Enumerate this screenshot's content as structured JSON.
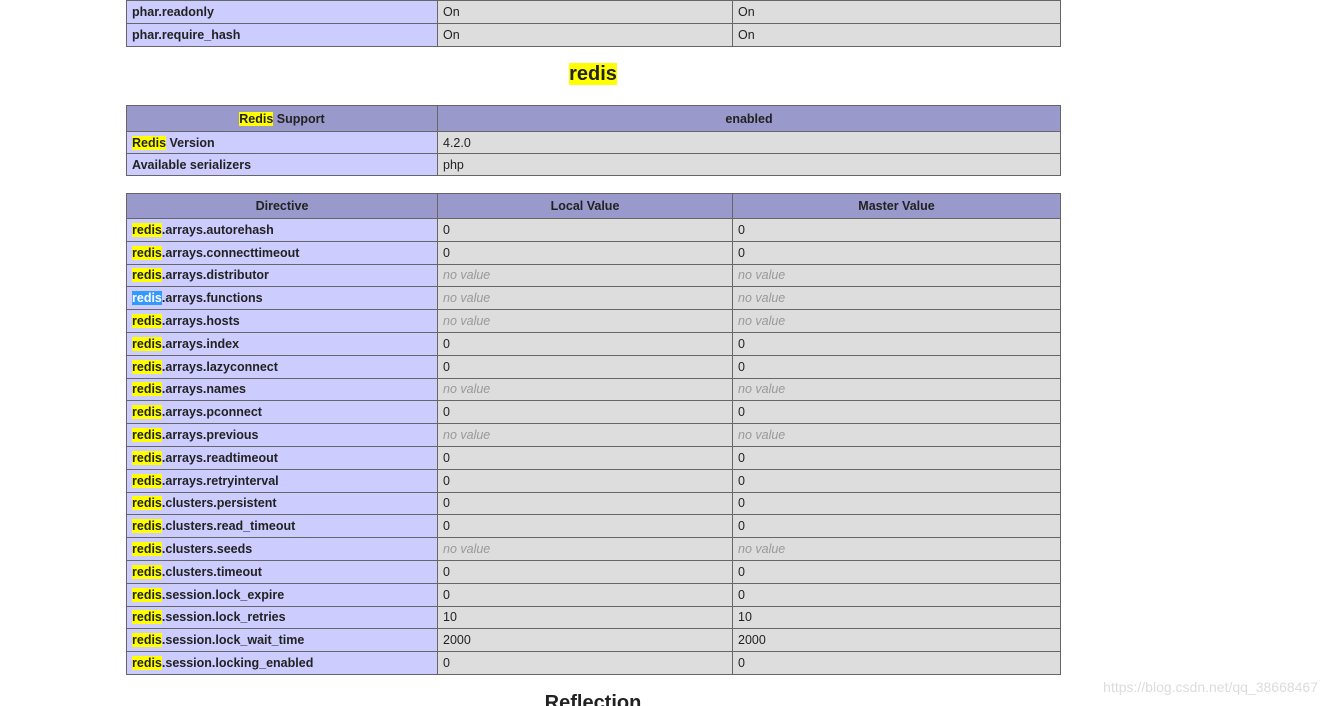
{
  "phar_rows": [
    {
      "name": "phar.readonly",
      "local": "On",
      "master": "On"
    },
    {
      "name": "phar.require_hash",
      "local": "On",
      "master": "On"
    }
  ],
  "redis_section": {
    "title": "redis",
    "support_header": {
      "keyword": "Redis",
      "rest": " Support",
      "value": "enabled"
    },
    "info_rows": [
      {
        "keyword": "Redis",
        "rest": " Version",
        "value": "4.2.0"
      },
      {
        "keyword": "",
        "rest": "Available serializers",
        "value": "php"
      }
    ],
    "directive_headers": {
      "directive": "Directive",
      "local": "Local Value",
      "master": "Master Value"
    },
    "directives": [
      {
        "prefix": "redis",
        "rest": ".arrays.autorehash",
        "local": "0",
        "master": "0",
        "novalue": false,
        "selected": false
      },
      {
        "prefix": "redis",
        "rest": ".arrays.connecttimeout",
        "local": "0",
        "master": "0",
        "novalue": false,
        "selected": false
      },
      {
        "prefix": "redis",
        "rest": ".arrays.distributor",
        "local": "no value",
        "master": "no value",
        "novalue": true,
        "selected": false
      },
      {
        "prefix": "redis",
        "rest": ".arrays.functions",
        "local": "no value",
        "master": "no value",
        "novalue": true,
        "selected": true
      },
      {
        "prefix": "redis",
        "rest": ".arrays.hosts",
        "local": "no value",
        "master": "no value",
        "novalue": true,
        "selected": false
      },
      {
        "prefix": "redis",
        "rest": ".arrays.index",
        "local": "0",
        "master": "0",
        "novalue": false,
        "selected": false
      },
      {
        "prefix": "redis",
        "rest": ".arrays.lazyconnect",
        "local": "0",
        "master": "0",
        "novalue": false,
        "selected": false
      },
      {
        "prefix": "redis",
        "rest": ".arrays.names",
        "local": "no value",
        "master": "no value",
        "novalue": true,
        "selected": false
      },
      {
        "prefix": "redis",
        "rest": ".arrays.pconnect",
        "local": "0",
        "master": "0",
        "novalue": false,
        "selected": false
      },
      {
        "prefix": "redis",
        "rest": ".arrays.previous",
        "local": "no value",
        "master": "no value",
        "novalue": true,
        "selected": false
      },
      {
        "prefix": "redis",
        "rest": ".arrays.readtimeout",
        "local": "0",
        "master": "0",
        "novalue": false,
        "selected": false
      },
      {
        "prefix": "redis",
        "rest": ".arrays.retryinterval",
        "local": "0",
        "master": "0",
        "novalue": false,
        "selected": false
      },
      {
        "prefix": "redis",
        "rest": ".clusters.persistent",
        "local": "0",
        "master": "0",
        "novalue": false,
        "selected": false
      },
      {
        "prefix": "redis",
        "rest": ".clusters.read_timeout",
        "local": "0",
        "master": "0",
        "novalue": false,
        "selected": false
      },
      {
        "prefix": "redis",
        "rest": ".clusters.seeds",
        "local": "no value",
        "master": "no value",
        "novalue": true,
        "selected": false
      },
      {
        "prefix": "redis",
        "rest": ".clusters.timeout",
        "local": "0",
        "master": "0",
        "novalue": false,
        "selected": false
      },
      {
        "prefix": "redis",
        "rest": ".session.lock_expire",
        "local": "0",
        "master": "0",
        "novalue": false,
        "selected": false
      },
      {
        "prefix": "redis",
        "rest": ".session.lock_retries",
        "local": "10",
        "master": "10",
        "novalue": false,
        "selected": false
      },
      {
        "prefix": "redis",
        "rest": ".session.lock_wait_time",
        "local": "2000",
        "master": "2000",
        "novalue": false,
        "selected": false
      },
      {
        "prefix": "redis",
        "rest": ".session.locking_enabled",
        "local": "0",
        "master": "0",
        "novalue": false,
        "selected": false
      }
    ]
  },
  "next_section_title": "Reflection",
  "watermark": "https://blog.csdn.net/qq_38668467",
  "colors": {
    "header_bg": "#9999cc",
    "key_bg": "#ccccff",
    "value_bg": "#dddddd",
    "highlight": "#ffff00",
    "selection": "#3399ff"
  }
}
